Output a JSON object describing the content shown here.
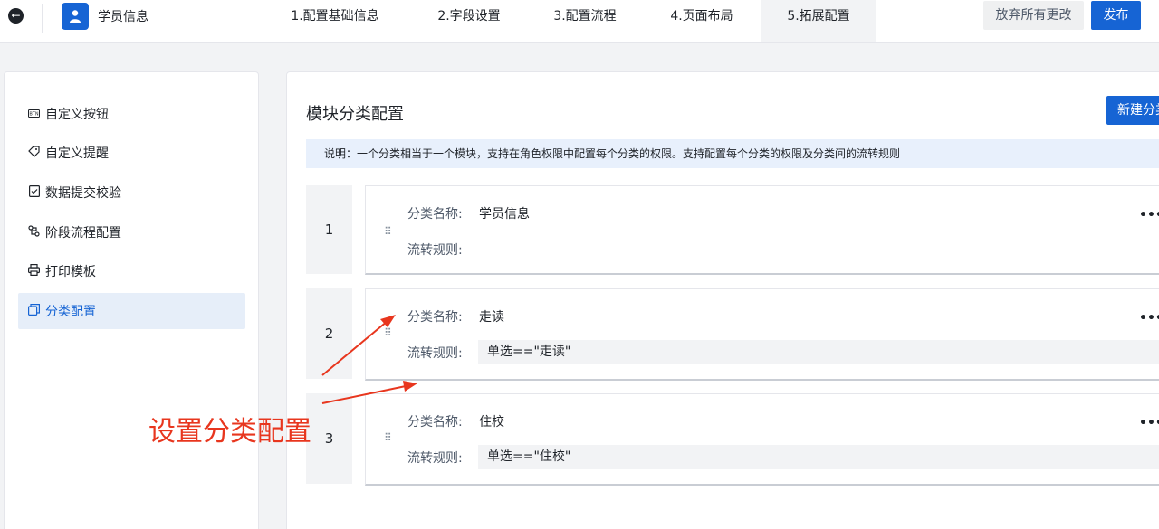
{
  "header": {
    "app_title": "学员信息",
    "steps": [
      {
        "label": "1.配置基础信息",
        "active": false
      },
      {
        "label": "2.字段设置",
        "active": false
      },
      {
        "label": "3.配置流程",
        "active": false
      },
      {
        "label": "4.页面布局",
        "active": false
      },
      {
        "label": "5.拓展配置",
        "active": true
      }
    ],
    "discard_label": "放弃所有更改",
    "publish_label": "发布"
  },
  "sidebar": {
    "items": [
      {
        "label": "自定义按钮",
        "icon": "btn-icon"
      },
      {
        "label": "自定义提醒",
        "icon": "tag-icon"
      },
      {
        "label": "数据提交校验",
        "icon": "check-doc-icon"
      },
      {
        "label": "阶段流程配置",
        "icon": "flow-icon"
      },
      {
        "label": "打印模板",
        "icon": "printer-icon"
      },
      {
        "label": "分类配置",
        "icon": "copy-icon",
        "active": true
      }
    ]
  },
  "main": {
    "title": "模块分类配置",
    "new_button_label": "新建分类",
    "notice": "说明：一个分类相当于一个模块，支持在角色权限中配置每个分类的权限。支持配置每个分类的权限及分类间的流转规则",
    "name_label": "分类名称:",
    "rule_label": "流转规则:",
    "more_label": "•••",
    "categories": [
      {
        "index": "1",
        "name": "学员信息",
        "rule": ""
      },
      {
        "index": "2",
        "name": "走读",
        "rule": "单选==\"走读\""
      },
      {
        "index": "3",
        "name": "住校",
        "rule": "单选==\"住校\""
      }
    ]
  },
  "annotation": {
    "text": "设置分类配置",
    "color": "#e8361e"
  },
  "colors": {
    "primary": "#1664d4",
    "active_nav_bg": "#e6eef9",
    "notice_bg": "#e8f0fc"
  }
}
